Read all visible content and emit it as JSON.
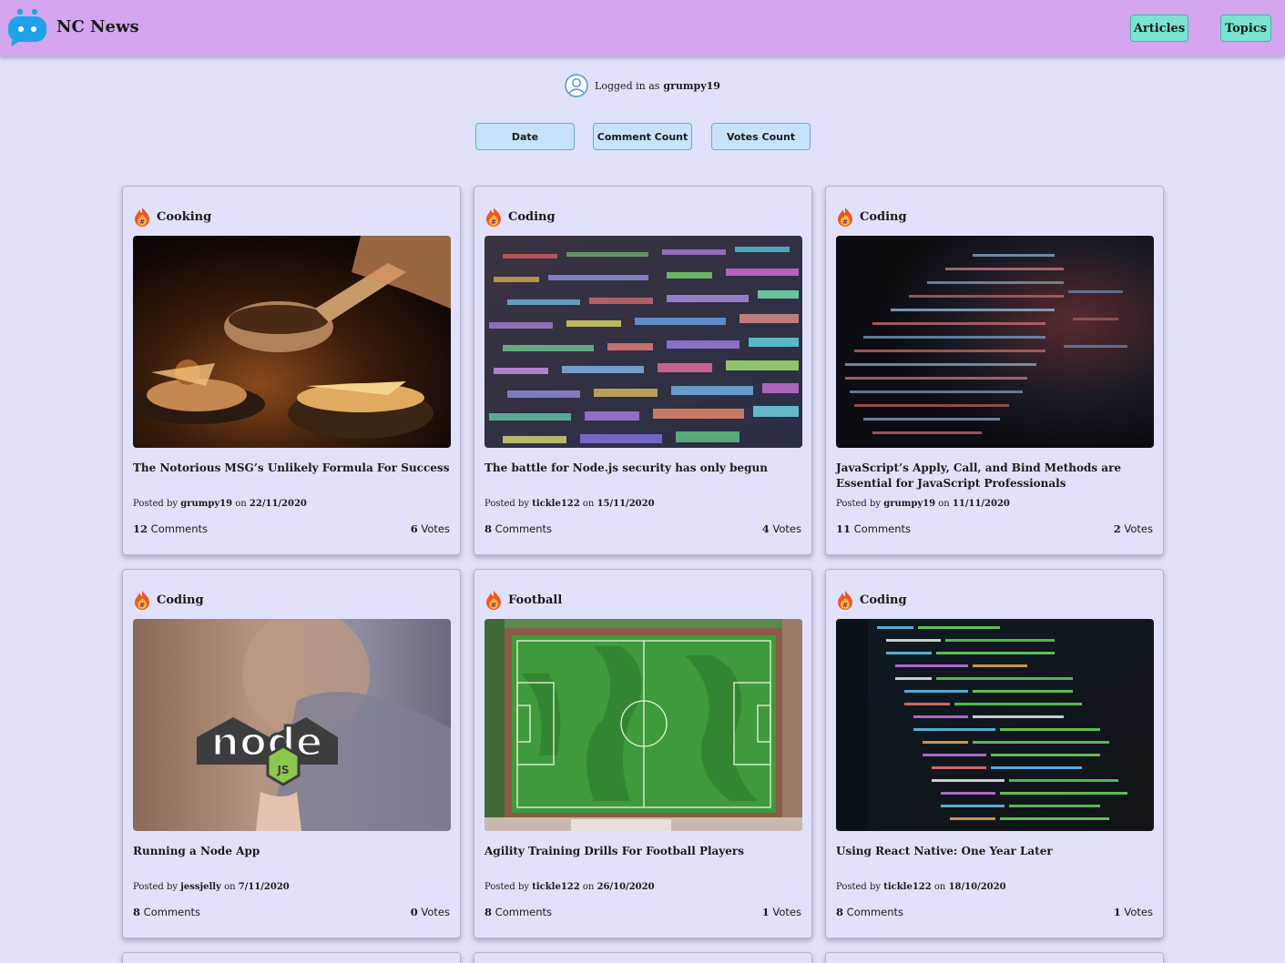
{
  "app": {
    "title": "NC News"
  },
  "nav": {
    "articles_label": "Articles",
    "topics_label": "Topics"
  },
  "login": {
    "prefix": "Logged in as",
    "username": "grumpy19"
  },
  "sort": {
    "date_label": "Date",
    "comment_count_label": "Comment Count",
    "votes_count_label": "Votes Count"
  },
  "labels": {
    "posted_by": "Posted by",
    "on": "on",
    "comments": "Comments",
    "votes": "Votes"
  },
  "colors": {
    "header": "#d3a6ef",
    "background": "#e1e1fb",
    "nav_button": "#7be3d1",
    "sort_button": "#c6e3fb"
  },
  "articles": [
    {
      "topic": "Cooking",
      "image": "cooking-photo",
      "title": "The Notorious MSG’s Unlikely Formula For Success",
      "author": "grumpy19",
      "date": "22/11/2020",
      "comment_count": "12",
      "votes": "6"
    },
    {
      "topic": "Coding",
      "image": "code-screen-photo",
      "title": "The battle for Node.js security has only begun",
      "author": "tickle122",
      "date": "15/11/2020",
      "comment_count": "8",
      "votes": "4"
    },
    {
      "topic": "Coding",
      "image": "dark-code-photo",
      "title": "JavaScript’s Apply, Call, and Bind Methods are Essential for JavaScript Professionals",
      "author": "grumpy19",
      "date": "11/11/2020",
      "comment_count": "11",
      "votes": "2"
    },
    {
      "topic": "Coding",
      "image": "node-sticker-photo",
      "title": "Running a Node App",
      "author": "jessjelly",
      "date": "7/11/2020",
      "comment_count": "8",
      "votes": "0"
    },
    {
      "topic": "Football",
      "image": "football-pitch-photo",
      "title": "Agility Training Drills For Football Players",
      "author": "tickle122",
      "date": "26/10/2020",
      "comment_count": "8",
      "votes": "1"
    },
    {
      "topic": "Coding",
      "image": "editor-code-photo",
      "title": "Using React Native: One Year Later",
      "author": "tickle122",
      "date": "18/10/2020",
      "comment_count": "8",
      "votes": "1"
    }
  ]
}
